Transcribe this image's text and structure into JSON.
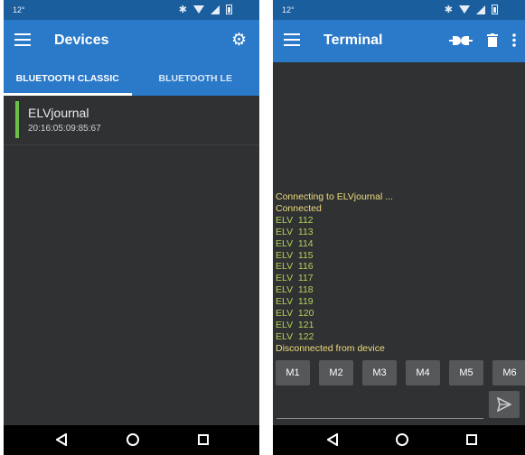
{
  "left": {
    "status": {
      "time": "12°"
    },
    "app_bar": {
      "title": "Devices",
      "menu_icon": "menu-icon",
      "settings_icon": "gear-icon"
    },
    "tabs": [
      {
        "label": "BLUETOOTH CLASSIC",
        "active": true
      },
      {
        "label": "BLUETOOTH LE",
        "active": false
      }
    ],
    "devices": [
      {
        "name": "ELVjournal",
        "address": "20:16:05:09:85:67"
      }
    ]
  },
  "right": {
    "status": {
      "time": "12°"
    },
    "app_bar": {
      "title": "Terminal",
      "menu_icon": "menu-icon",
      "icons": [
        "connect-icon",
        "trash-icon",
        "more-vert-icon"
      ]
    },
    "terminal_lines": [
      {
        "text": "Connecting to ELVjournal ...",
        "kind": "status"
      },
      {
        "text": "Connected",
        "kind": "status"
      },
      {
        "text": "ELV  112",
        "kind": "data"
      },
      {
        "text": "ELV  113",
        "kind": "data"
      },
      {
        "text": "ELV  114",
        "kind": "data"
      },
      {
        "text": "ELV  115",
        "kind": "data"
      },
      {
        "text": "ELV  116",
        "kind": "data"
      },
      {
        "text": "ELV  117",
        "kind": "data"
      },
      {
        "text": "ELV  118",
        "kind": "data"
      },
      {
        "text": "ELV  119",
        "kind": "data"
      },
      {
        "text": "ELV  120",
        "kind": "data"
      },
      {
        "text": "ELV  121",
        "kind": "data"
      },
      {
        "text": "ELV  122",
        "kind": "data"
      },
      {
        "text": "Disconnected from device",
        "kind": "status"
      }
    ],
    "macros": [
      "M1",
      "M2",
      "M3",
      "M4",
      "M5",
      "M6"
    ],
    "input": {
      "value": "",
      "send_icon": "send-icon"
    }
  },
  "colors": {
    "status_bar": "#1b5e9e",
    "app_bar": "#2b79c9",
    "background": "#2f3133",
    "status_text": "#f0dc7a",
    "data_text": "#b3d45a",
    "device_indicator": "#6cc04a"
  },
  "nav_icons": [
    "back-icon",
    "home-icon",
    "recent-apps-icon"
  ]
}
